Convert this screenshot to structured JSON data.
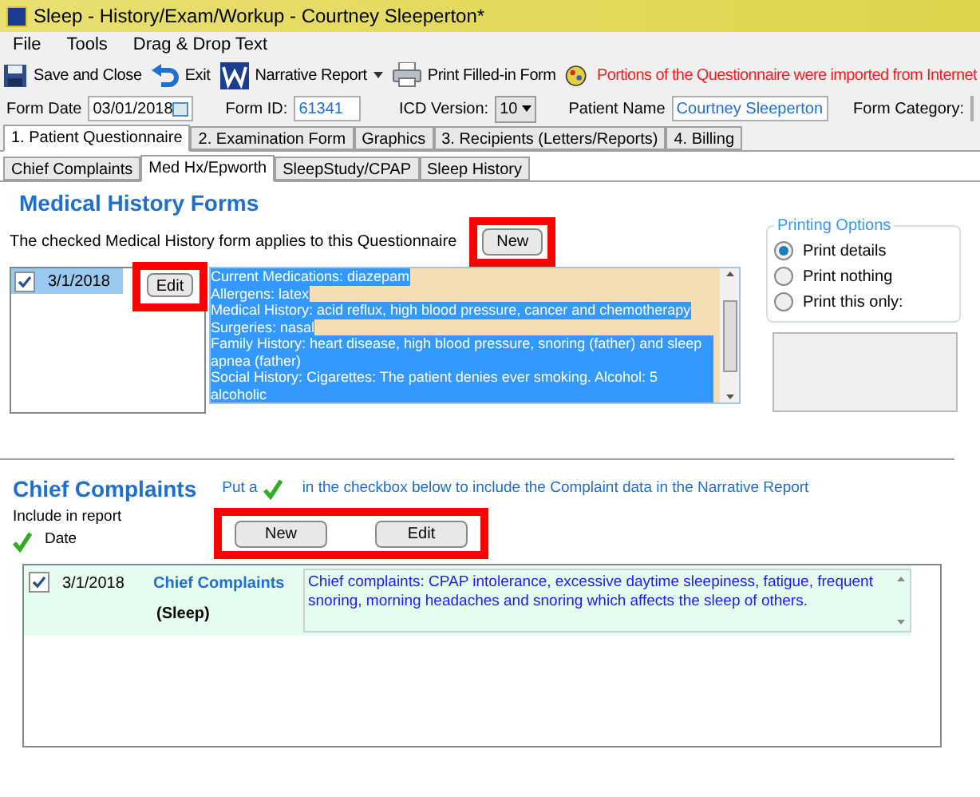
{
  "window": {
    "title": "Sleep - History/Exam/Workup - Courtney Sleeperton*"
  },
  "menu": [
    "File",
    "Tools",
    "Drag & Drop Text"
  ],
  "toolbar": [
    {
      "kind": "save",
      "label": "Save and Close"
    },
    {
      "kind": "exit",
      "label": "Exit"
    },
    {
      "kind": "word",
      "label": "Narrative Report",
      "dropdown": true
    },
    {
      "kind": "print",
      "label": "Print Filled-in Form"
    }
  ],
  "notice": "Portions of the Questionnaire were imported from Internet",
  "form": {
    "date_label": "Form Date",
    "date": "03/01/2018",
    "id_label": "Form ID:",
    "id": "61341",
    "icd_label": "ICD Version:",
    "icd": "10",
    "patient_label": "Patient Name",
    "patient": "Courtney Sleeperton",
    "category_label": "Form Category:"
  },
  "tabs": [
    {
      "label": "1. Patient Questionnaire",
      "selected": true
    },
    {
      "label": "2. Examination Form",
      "selected": false
    },
    {
      "label": "Graphics",
      "selected": false
    },
    {
      "label": "3. Recipients (Letters/Reports)",
      "selected": false
    },
    {
      "label": "4. Billing",
      "selected": false
    }
  ],
  "subtabs": [
    {
      "label": "Chief Complaints",
      "selected": false
    },
    {
      "label": "Med Hx/Epworth",
      "selected": true
    },
    {
      "label": "SleepStudy/CPAP",
      "selected": false
    },
    {
      "label": "Sleep History",
      "selected": false
    }
  ],
  "medical_history": {
    "title": "Medical History Forms",
    "note": "The checked Medical History form applies to this Questionnaire",
    "new_button": "New",
    "edit_button": "Edit",
    "forms": [
      {
        "date": "3/1/2018",
        "checked": true,
        "selected": true
      }
    ],
    "details": [
      "Current Medications: diazepam",
      "Allergens: latex",
      "Medical History: acid reflux, high blood pressure, cancer and chemotherapy",
      "Surgeries: nasal",
      "Family History: heart disease, high blood pressure, snoring (father) and sleep apnea (father)",
      "Social History: Cigarettes: The patient denies ever smoking.  Alcohol: 5 alcoholic"
    ]
  },
  "printing_options": {
    "title": "Printing Options",
    "options": [
      {
        "label": "Print details",
        "selected": true
      },
      {
        "label": "Print nothing",
        "selected": false
      },
      {
        "label": "Print this only:",
        "selected": false
      }
    ]
  },
  "chief_complaints": {
    "title": "Chief Complaints",
    "hint_before": "Put a",
    "hint_after": "in the checkbox below to include the Complaint data in the Narrative Report",
    "include_label": "Include in report",
    "date_label": "Date",
    "new_button": "New",
    "edit_button": "Edit",
    "rows": [
      {
        "checked": true,
        "date": "3/1/2018",
        "name": "Chief Complaints",
        "category": "(Sleep)",
        "text": "Chief complaints: CPAP intolerance, excessive daytime sleepiness, fatigue, frequent snoring, morning headaches and snoring which affects the sleep of others."
      }
    ]
  }
}
